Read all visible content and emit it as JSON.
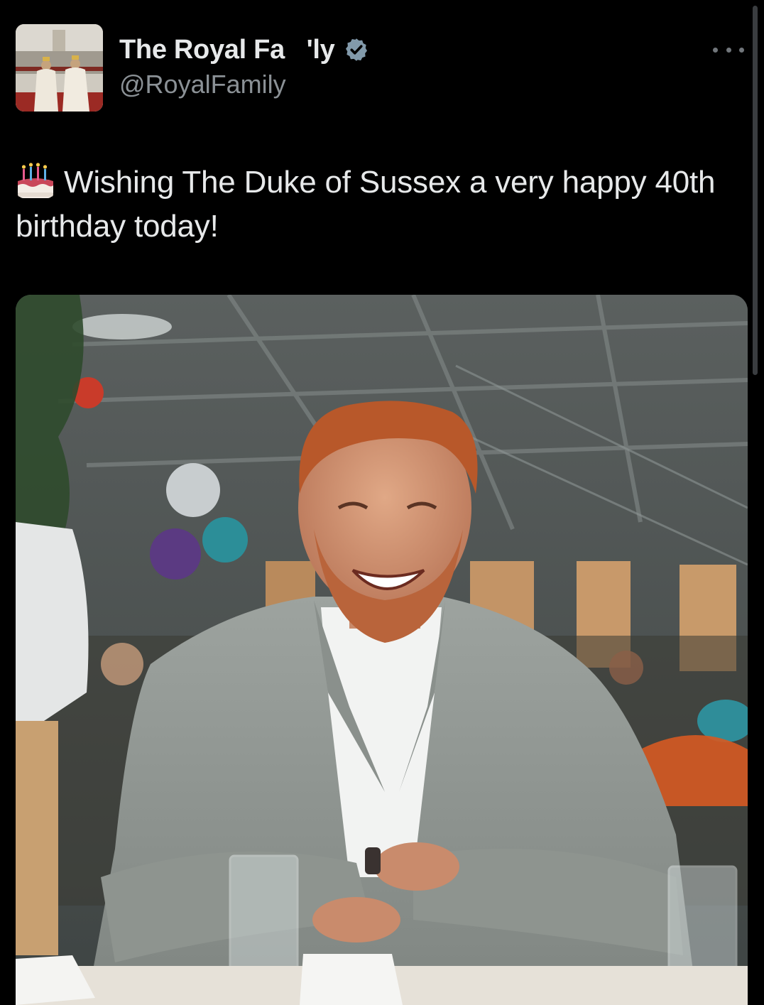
{
  "post": {
    "author": {
      "display_name": "The Royal Fa   'ly",
      "handle": "@RoyalFamily",
      "verified_icon": "verified-badge-icon",
      "avatar": "profile-photo"
    },
    "menu_icon": "more-options-icon",
    "text": {
      "emoji": "birthday-cake-icon",
      "body": "Wishing The Duke of Sussex a very happy 40th birthday today!"
    },
    "media": {
      "type": "photo",
      "place_card_text": "",
      "scrollbar": "vertical-scrollbar"
    }
  },
  "colors": {
    "background": "#000000",
    "primary_text": "#e7e9ea",
    "secondary_text": "#8b9196",
    "verified": "#829aab"
  }
}
